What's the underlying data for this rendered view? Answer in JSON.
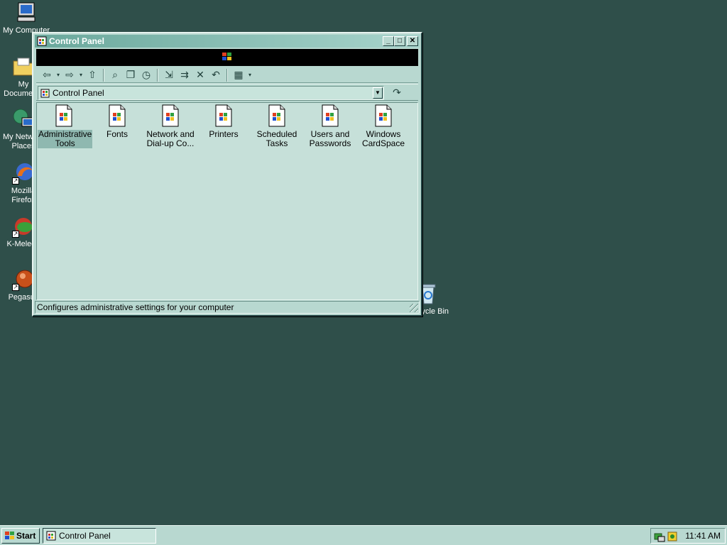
{
  "desktop": {
    "icons": [
      {
        "label": "My Computer",
        "icon": "computer-icon"
      },
      {
        "label": "My Documents",
        "icon": "folder-documents-icon"
      },
      {
        "label": "My Network Places",
        "icon": "network-icon"
      },
      {
        "label": "Mozilla Firefox",
        "icon": "firefox-icon"
      },
      {
        "label": "K-Meleon",
        "icon": "kmeleon-icon"
      },
      {
        "label": "Pegasus",
        "icon": "pegasus-icon"
      },
      {
        "label": "Recycle Bin",
        "icon": "recycle-bin-icon"
      }
    ]
  },
  "window": {
    "title": "Control Panel",
    "buttons": {
      "minimize": "_",
      "maximize": "□",
      "close": "✕"
    },
    "toolbar": {
      "back": "⇦",
      "dropdown": "▾",
      "forward": "⇨",
      "up": "⇧",
      "search": "⌕",
      "folders": "❐",
      "history": "◷",
      "move_to": "⇲",
      "copy_to": "⇉",
      "delete": "✕",
      "undo": "↶",
      "views": "▦"
    },
    "address": {
      "value": "Control Panel",
      "dropdown": "▼",
      "go": "↷"
    },
    "items": [
      {
        "label": "Administrative Tools",
        "selected": true
      },
      {
        "label": "Fonts",
        "selected": false
      },
      {
        "label": "Network and Dial-up Co...",
        "selected": false
      },
      {
        "label": "Printers",
        "selected": false
      },
      {
        "label": "Scheduled Tasks",
        "selected": false
      },
      {
        "label": "Users and Passwords",
        "selected": false
      },
      {
        "label": "Windows CardSpace",
        "selected": false
      }
    ],
    "status": "Configures administrative settings for your computer"
  },
  "taskbar": {
    "start_label": "Start",
    "task_label": "Control Panel",
    "clock": "11:41 AM"
  },
  "colors": {
    "desktop": "#2f4f4a",
    "window_face": "#b8d8d0",
    "content_bg": "#c6e0d9",
    "selection": "#8fb8b0"
  }
}
